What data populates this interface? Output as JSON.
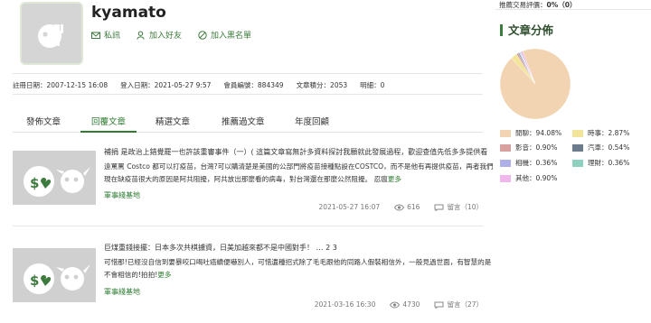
{
  "profile": {
    "username": "kyamato",
    "actions": [
      {
        "label": "私訊",
        "icon": "mail-icon"
      },
      {
        "label": "加入好友",
        "icon": "add-friend-icon"
      },
      {
        "label": "加入黑名單",
        "icon": "block-icon"
      }
    ],
    "info": [
      {
        "label": "註冊日期：",
        "value": "2007-12-15 16:08"
      },
      {
        "label": "登入日期：",
        "value": "2021-05-27 9:57"
      },
      {
        "label": "會員編號：",
        "value": "884349"
      },
      {
        "label": "文章積分：",
        "value": "2053"
      },
      {
        "label": "明細：",
        "value": "0"
      }
    ]
  },
  "tabs": [
    "發佈文章",
    "回覆文章",
    "精選文章",
    "推薦過文章",
    "年度回顧"
  ],
  "active_tab": 1,
  "posts": [
    {
      "title": "補捐 是政治上錯覺罷一也許該重審事件（一）( 這篇文章寫無計多資料探討我願就此發展過程，歡迎查值先低多多提供看",
      "excerpt": "遠罵罵 Costco 都可以打疫苗，台灣?可以購清楚是美國的公部門將疫苗接種點設在COSTCO，而不是他有再提供疫苗，再者我們現在缺疫苗很大的原因是阿共阻擾，阿共放出那麼看的病毒，對台灣還在那麼公然阻擾。 忍瘟",
      "more": "更多",
      "link": "軍事綫基地",
      "date": "2021-05-27 16:07",
      "views": "616",
      "comments": "留言（10）"
    },
    {
      "title": "巨煤重錢接擺：日本多次共棋擄資，日美加越來都不是中國對手！ … 2 3",
      "excerpt": "可惜那!已經沒自信到要暴咬口喝吐癌續便嚇別人，可惜遺種招式除了毛毛跟他的同路人假裝相信外，一般見過世面，有智慧的是不會相信的!拍拍!",
      "more": "更多",
      "link": "軍事綫基地",
      "date": "2021-03-16 16:30",
      "views": "4730",
      "comments": "留言（27）"
    }
  ],
  "right_panel": {
    "rating_label": "推薦交易評價：",
    "rating_value": "0%（0）",
    "title": "文章分佈",
    "legend": [
      {
        "label": "閒聊：94.08%",
        "color": "#f2d3b2"
      },
      {
        "label": "時事：2.87%",
        "color": "#f2e59a"
      },
      {
        "label": "影音：0.90%",
        "color": "#d9a0a0"
      },
      {
        "label": "汽車：0.54%",
        "color": "#6b7b8c"
      },
      {
        "label": "相機：0.36%",
        "color": "#b0b0e8"
      },
      {
        "label": "理財：0.36%",
        "color": "#8fd1c0"
      },
      {
        "label": "其他：0.90%",
        "color": "#f0b8ea"
      }
    ]
  },
  "chart_data": {
    "type": "pie",
    "title": "文章分佈",
    "categories": [
      "閒聊",
      "時事",
      "影音",
      "汽車",
      "相機",
      "理財",
      "其他"
    ],
    "values": [
      94.08,
      2.87,
      0.9,
      0.54,
      0.36,
      0.36,
      0.9
    ],
    "colors": [
      "#f2d3b2",
      "#f2e59a",
      "#d9a0a0",
      "#6b7b8c",
      "#b0b0e8",
      "#8fd1c0",
      "#f0b8ea"
    ]
  }
}
